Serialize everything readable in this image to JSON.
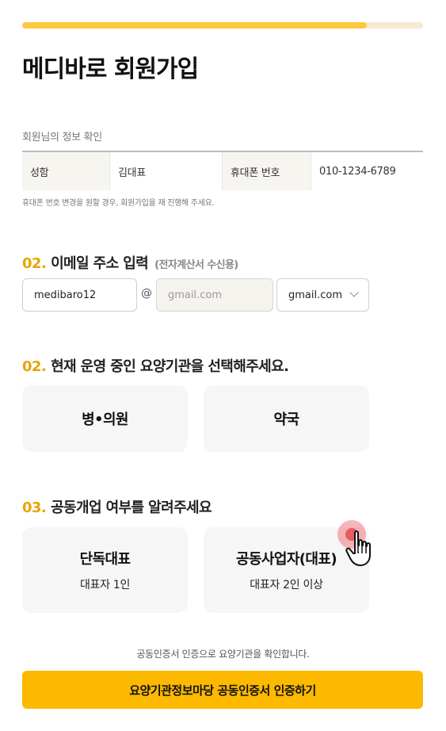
{
  "progress": {
    "fraction": 0.86,
    "colors": {
      "fill": "#fcc83f",
      "track": "#f6ead2"
    }
  },
  "page_title": "메디바로 회원가입",
  "member_info": {
    "section_label": "회원님의 정보 확인",
    "name_label": "성함",
    "name_value": "김대표",
    "phone_label": "휴대폰 번호",
    "phone_value": "010-1234-6789",
    "note": "휴대폰 번호 변경을 원할 경우, 회원가입을 재 진행해 주세요."
  },
  "email_section": {
    "number": "02.",
    "title": "이메일 주소 입력",
    "subtitle": "(전자계산서 수신용)",
    "local_part_value": "medibaro12",
    "at_sign": "@",
    "domain_placeholder": "gmail.com",
    "domain_select_value": "gmail.com",
    "select_icon": "chevron-down-icon"
  },
  "facility_section": {
    "number": "02.",
    "title": "현재 운영 중인 요양기관을 선택해주세요.",
    "options": [
      {
        "label": "병•의원"
      },
      {
        "label": "약국"
      }
    ]
  },
  "ownership_section": {
    "number": "03.",
    "title": "공동개업 여부를 알려주세요",
    "options": [
      {
        "label": "단독대표",
        "sub": "대표자 1인"
      },
      {
        "label": "공동사업자(대표)",
        "sub": "대표자 2인 이상"
      }
    ]
  },
  "cta": {
    "note": "공동인증서 인증으로 요양기관을 확인합니다.",
    "button_label": "요양기관정보마당 공동인증서 인증하기",
    "color": "#fdb900"
  },
  "accent_color": "#e7a500"
}
